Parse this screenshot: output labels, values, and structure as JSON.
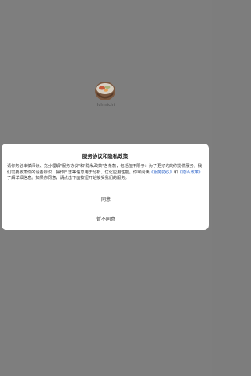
{
  "app": {
    "name": "Ichinichi",
    "logo_icon": "food-bowl-icon"
  },
  "dialog": {
    "title": "服务协议和隐私政策",
    "body_part1": "请你务必审慎阅读、充分理解\"服务协议\"和\"隐私政策\"各条款，包括但不限于：为了更好的向你提供服务，我们需要收集你的设备标识、操作日志等信息用于分析、优化应用性能。你可阅读",
    "service_link": "《服务协议》",
    "body_and": "和",
    "privacy_link": "《隐私政策》",
    "body_part2": "了解详细信息。如果你同意，请点击下面按钮开始接受我们的服务。",
    "agree_label": "同意",
    "disagree_label": "暂不同意"
  },
  "colors": {
    "overlay": "#7e7e7e",
    "dialog_bg": "#ffffff",
    "link": "#2a62c9"
  }
}
